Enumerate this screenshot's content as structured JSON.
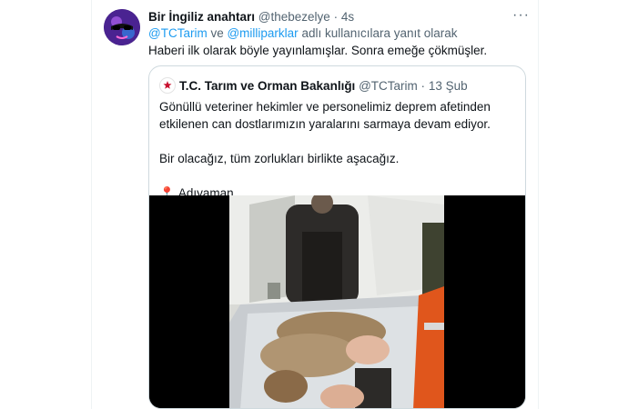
{
  "tweet": {
    "author_name": "Bir İngiliz anahtarı",
    "author_handle": "@thebezelye",
    "separator": "·",
    "time": "4s",
    "more_icon": "more-icon",
    "reply_mention_1": "@TCTarim",
    "reply_and": " ve ",
    "reply_mention_2": "@milliparklar",
    "reply_suffix": " adlı kullanıcılara yanıt olarak",
    "text": "Haberi ilk olarak böyle yayınlamışlar. Sonra emeğe çökmüşler."
  },
  "quote": {
    "author_name": "T.C. Tarım ve Orman Bakanlığı",
    "author_handle": "@TCTarim",
    "separator": "·",
    "date": "13 Şub",
    "line_1": "Gönüllü veteriner hekimler ve personelimiz deprem afetinden",
    "line_2": "etkilenen can dostlarımızın yaralarını sarmaya devam ediyor.",
    "line_3": "Bir olacağız, tüm zorlukları birlikte aşacağız.",
    "location_icon": "pin-icon",
    "location": "Adıyaman"
  },
  "colors": {
    "link": "#1d9bf0",
    "secondary": "#536471",
    "primary_text": "#0f1419",
    "border": "#cfd9de",
    "ministry_red": "#c8102e"
  }
}
